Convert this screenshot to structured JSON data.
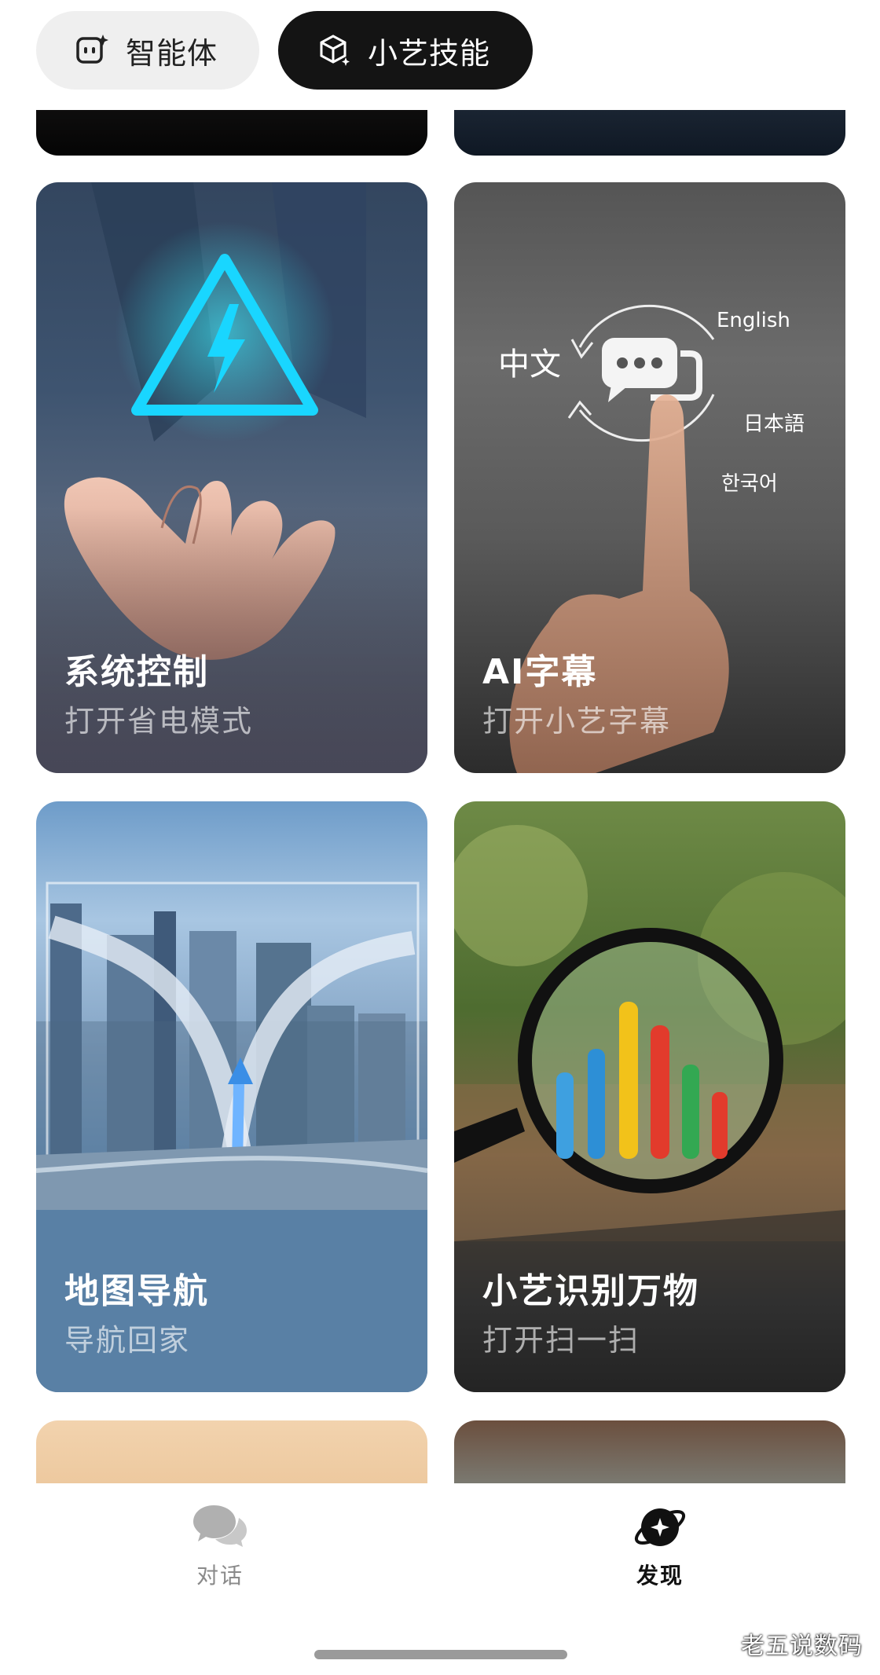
{
  "tabs": [
    {
      "label": "智能体",
      "icon": "agent-icon",
      "selected": false
    },
    {
      "label": "小艺技能",
      "icon": "skill-cube-icon",
      "selected": true
    }
  ],
  "cards": {
    "top_left": {
      "title": "",
      "sub": ""
    },
    "system_control": {
      "title": "系统控制",
      "sub": "打开省电模式"
    },
    "ai_subtitle": {
      "title": "AI字幕",
      "sub": "打开小艺字幕",
      "art_labels": {
        "zh": "中文",
        "en": "English",
        "ja": "日本語",
        "ko": "한국어"
      }
    },
    "map_nav": {
      "title": "地图导航",
      "sub": "导航回家"
    },
    "recognize": {
      "title": "小艺识别万物",
      "sub": "打开扫一扫"
    }
  },
  "nav": {
    "chat": {
      "label": "对话",
      "icon": "chat-bubbles-icon"
    },
    "discover": {
      "label": "发现",
      "icon": "discover-planet-icon"
    }
  },
  "watermark": "老五说数码",
  "colors": {
    "accent_dark": "#141414",
    "pill_light": "#efefef",
    "power_icon": "#19d6ff"
  }
}
